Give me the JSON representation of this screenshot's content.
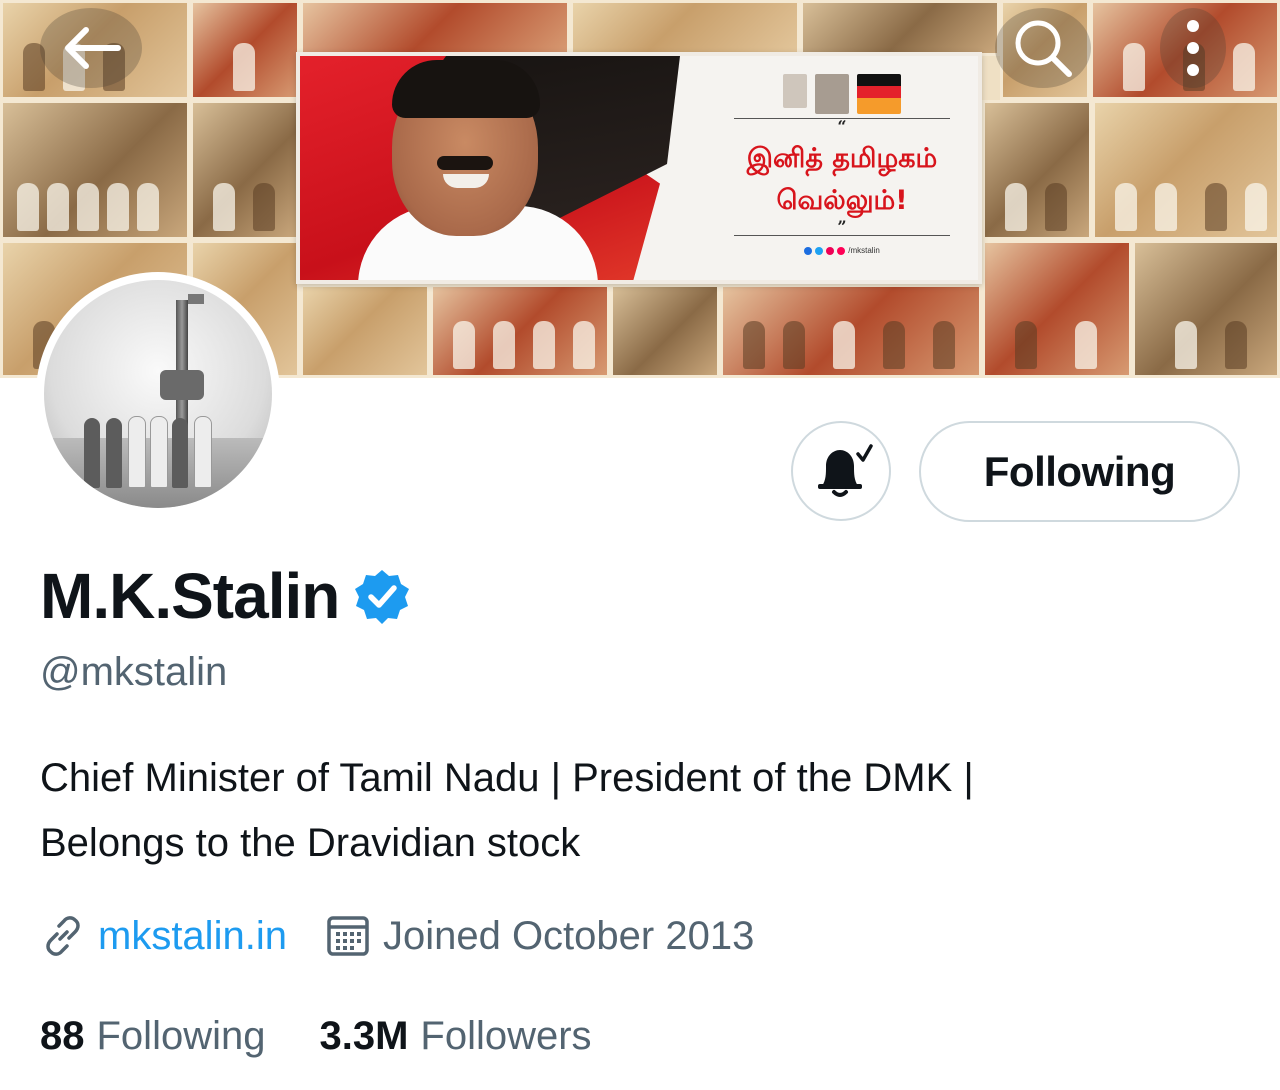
{
  "banner": {
    "poster": {
      "headline_line1": "இனித் தமிழகம்",
      "headline_line2": "வெல்லும்!",
      "open_quote": "“",
      "close_quote": "”",
      "handle": "/mkstalin"
    }
  },
  "top_bar": {
    "back_icon": "arrow-left-icon",
    "search_icon": "search-icon",
    "more_icon": "more-vertical-icon"
  },
  "actions": {
    "notifications_icon": "bell-check-icon",
    "follow_label": "Following"
  },
  "profile": {
    "name": "M.K.Stalin",
    "verified": true,
    "handle": "@mkstalin",
    "bio_line1": "Chief Minister of Tamil Nadu | President of the DMK |",
    "bio_line2": "Belongs to the Dravidian stock",
    "website": "mkstalin.in",
    "joined": "Joined October 2013",
    "following_count": "88",
    "following_label": "Following",
    "followers_count": "3.3M",
    "followers_label": "Followers"
  },
  "colors": {
    "accent": "#1d9bf0",
    "secondary_text": "#536471",
    "primary_text": "#0f1419",
    "border": "#cfd9de"
  }
}
